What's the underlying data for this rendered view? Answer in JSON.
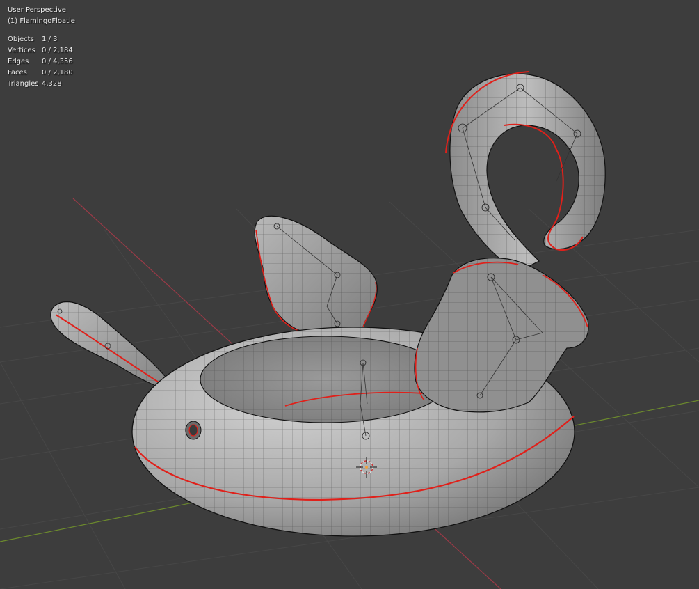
{
  "viewport": {
    "view_name": "User Perspective",
    "active_object": "(1) FlamingoFloatie",
    "stats": [
      {
        "label": "Objects",
        "value": "1 / 3"
      },
      {
        "label": "Vertices",
        "value": "0 / 2,184"
      },
      {
        "label": "Edges",
        "value": "0 / 4,356"
      },
      {
        "label": "Faces",
        "value": "0 / 2,180"
      },
      {
        "label": "Triangles",
        "value": "4,328"
      }
    ]
  },
  "colors": {
    "background": "#3d3d3d",
    "grid": "#4a4a4a",
    "x_axis": "#9b3a47",
    "y_axis": "#6c8a2d",
    "mesh_fill": "#9c9c9c",
    "wire": "#1a1a1a",
    "seam": "#e0201a"
  },
  "icons": [
    "3d-cursor-icon"
  ]
}
